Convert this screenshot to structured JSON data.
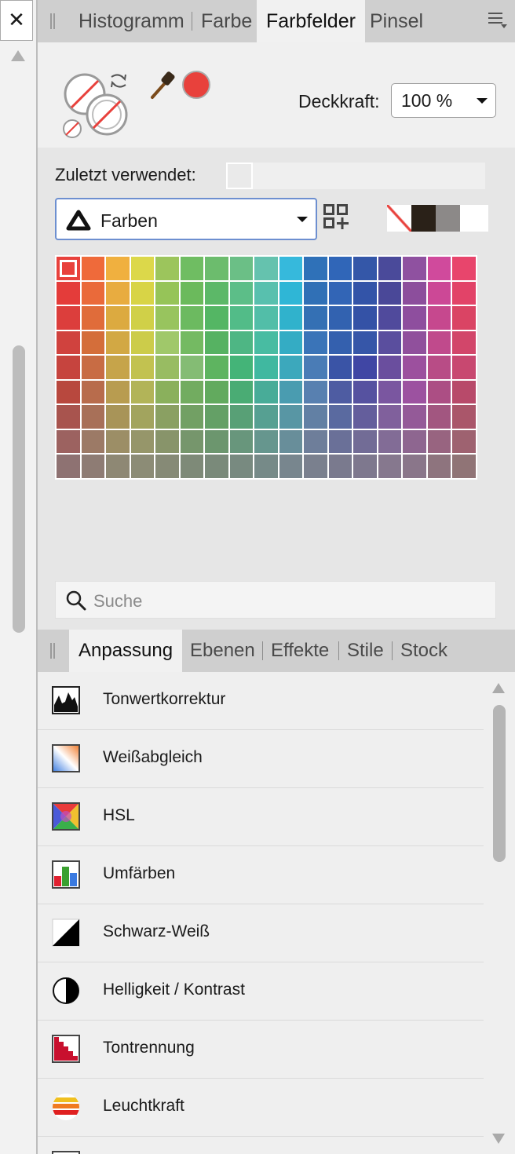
{
  "left_panel": {
    "close_glyph": "✕"
  },
  "top_tabs": [
    {
      "label": "Histogramm",
      "active": false
    },
    {
      "label": "Farbe",
      "active": false
    },
    {
      "label": "Farbfelder",
      "active": true
    },
    {
      "label": "Pinsel",
      "active": false
    }
  ],
  "swatches": {
    "current_color": "#e8413c",
    "opacity_label": "Deckkraft:",
    "opacity_value": "100 %",
    "recent_label": "Zuletzt verwendet:",
    "palette_name": "Farben",
    "quick_swatches": [
      "none",
      "#2a2118",
      "#8c8988",
      "#ffffff"
    ],
    "search_placeholder": "Suche",
    "grid_colors": [
      [
        "#e8413c",
        "#ef6a3a",
        "#f0b03f",
        "#dcd84a",
        "#9cc55c",
        "#6fbd62",
        "#6cbc6d",
        "#6bbf86",
        "#65c2ae",
        "#36b9dc",
        "#2f71b8",
        "#3066b8",
        "#3457a8",
        "#4a4a9a",
        "#8f51a0",
        "#d04a9c",
        "#e8456c"
      ],
      [
        "#e43c3a",
        "#ea6a3a",
        "#e8ac40",
        "#d8d446",
        "#96c458",
        "#6bba5c",
        "#5cb868",
        "#5cbe88",
        "#58c0ae",
        "#2fb6d6",
        "#3070b6",
        "#3265b6",
        "#3354a8",
        "#4a4898",
        "#8c4e9c",
        "#cc4896",
        "#e24368"
      ],
      [
        "#dc3e3c",
        "#e06c3a",
        "#dcaa40",
        "#d0d048",
        "#98c45e",
        "#6cba60",
        "#54b664",
        "#52bc88",
        "#52bea8",
        "#30b2cc",
        "#3470b4",
        "#3262b0",
        "#3452a6",
        "#504a9c",
        "#8e4e9e",
        "#c6488e",
        "#da4464"
      ],
      [
        "#d0423e",
        "#d46e3a",
        "#d2a844",
        "#cccc4a",
        "#a0c86a",
        "#74ba62",
        "#56b262",
        "#4eb684",
        "#48bca2",
        "#34acc4",
        "#3a74b8",
        "#3460ae",
        "#3656a8",
        "#5a4e9e",
        "#90509c",
        "#c04a8c",
        "#d2466a"
      ],
      [
        "#c6443e",
        "#c86c44",
        "#c6a44a",
        "#c2c250",
        "#98bc62",
        "#84bc74",
        "#5eb460",
        "#44b478",
        "#40b8a0",
        "#3ca8bc",
        "#4a7cb6",
        "#3a54a6",
        "#4046a4",
        "#6a4e9e",
        "#9c509e",
        "#b84c86",
        "#c84870"
      ],
      [
        "#b8483e",
        "#b86c4c",
        "#b89c50",
        "#b2b458",
        "#8ab05c",
        "#72ac60",
        "#62aa5e",
        "#4aac74",
        "#48ac98",
        "#4a9cb0",
        "#5880b0",
        "#4e5ca2",
        "#5652a0",
        "#7a56a0",
        "#9c52a0",
        "#ac4e84",
        "#b84a6a"
      ],
      [
        "#a8544e",
        "#a87058",
        "#a89458",
        "#a2a45e",
        "#8aa062",
        "#72a064",
        "#64a066",
        "#58a076",
        "#56a092",
        "#5896a4",
        "#6280a4",
        "#5a6aa0",
        "#645e9c",
        "#80609c",
        "#945a98",
        "#a25680",
        "#aa566a"
      ],
      [
        "#9c6260",
        "#9c7a66",
        "#9c8e66",
        "#96966a",
        "#88946a",
        "#76966c",
        "#6c966e",
        "#68967c",
        "#66968e",
        "#688e9a",
        "#6e7e9a",
        "#6a7098",
        "#726c96",
        "#826c96",
        "#8e6690",
        "#986480",
        "#9e6270"
      ],
      [
        "#8e7272",
        "#8e7c74",
        "#8e8874",
        "#8c8c76",
        "#868a76",
        "#7e8a78",
        "#7a8a7a",
        "#788a80",
        "#768a88",
        "#78868e",
        "#7a808e",
        "#7a7a8e",
        "#7e788e",
        "#86788e",
        "#8a768a",
        "#8e747e",
        "#907476"
      ]
    ]
  },
  "bottom_tabs": [
    {
      "label": "Anpassung",
      "active": true
    },
    {
      "label": "Ebenen",
      "active": false
    },
    {
      "label": "Effekte",
      "active": false
    },
    {
      "label": "Stile",
      "active": false
    },
    {
      "label": "Stock",
      "active": false
    }
  ],
  "adjustments": [
    {
      "label": "Tonwertkorrektur",
      "icon": "levels-icon"
    },
    {
      "label": "Weißabgleich",
      "icon": "white-balance-icon"
    },
    {
      "label": "HSL",
      "icon": "hsl-icon"
    },
    {
      "label": "Umfärben",
      "icon": "recolor-icon"
    },
    {
      "label": "Schwarz-Weiß",
      "icon": "black-white-icon"
    },
    {
      "label": "Helligkeit / Kontrast",
      "icon": "brightness-contrast-icon"
    },
    {
      "label": "Tontrennung",
      "icon": "posterize-icon"
    },
    {
      "label": "Leuchtkraft",
      "icon": "vibrance-icon"
    }
  ]
}
